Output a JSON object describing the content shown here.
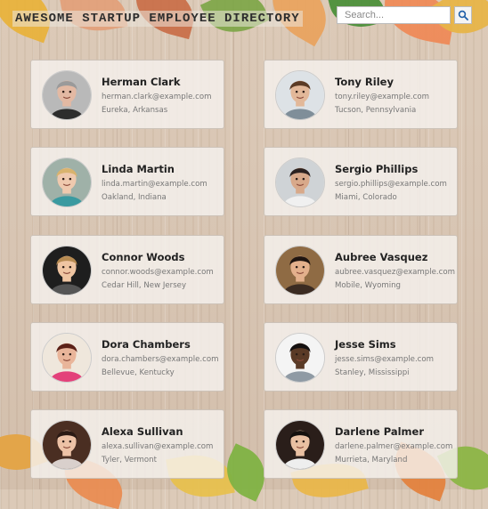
{
  "header": {
    "title": "AWESOME STARTUP EMPLOYEE DIRECTORY"
  },
  "search": {
    "placeholder": "Search...",
    "value": "",
    "icon": "magnifier-icon"
  },
  "employees": [
    {
      "name": "Herman Clark",
      "email": "herman.clark@example.com",
      "location": "Eureka, Arkansas",
      "avatar_bg": "#b9b9b9",
      "skin": "#e3b9a3",
      "hair": "#9a9a9a",
      "shirt": "#2d2d2d"
    },
    {
      "name": "Tony Riley",
      "email": "tony.riley@example.com",
      "location": "Tucson, Pennsylvania",
      "avatar_bg": "#dde2e6",
      "skin": "#e2b899",
      "hair": "#5b3b25",
      "shirt": "#7f8e99"
    },
    {
      "name": "Linda Martin",
      "email": "linda.martin@example.com",
      "location": "Oakland, Indiana",
      "avatar_bg": "#9fb1a8",
      "skin": "#efc9ae",
      "hair": "#d9b36e",
      "shirt": "#3a9aa0"
    },
    {
      "name": "Sergio Phillips",
      "email": "sergio.phillips@example.com",
      "location": "Miami, Colorado",
      "avatar_bg": "#cfd3d6",
      "skin": "#d8a98a",
      "hair": "#2c2220",
      "shirt": "#f0f0f0"
    },
    {
      "name": "Connor Woods",
      "email": "connor.woods@example.com",
      "location": "Cedar Hill, New Jersey",
      "avatar_bg": "#1e1e1e",
      "skin": "#efc5a2",
      "hair": "#b78b52",
      "shirt": "#555555"
    },
    {
      "name": "Aubree Vasquez",
      "email": "aubree.vasquez@example.com",
      "location": "Mobile, Wyoming",
      "avatar_bg": "#8f6b44",
      "skin": "#e3b08c",
      "hair": "#1f1410",
      "shirt": "#3b2b22"
    },
    {
      "name": "Dora Chambers",
      "email": "dora.chambers@example.com",
      "location": "Bellevue, Kentucky",
      "avatar_bg": "#efe7dc",
      "skin": "#e9b59a",
      "hair": "#5b2016",
      "shirt": "#e3417a"
    },
    {
      "name": "Jesse Sims",
      "email": "jesse.sims@example.com",
      "location": "Stanley, Mississippi",
      "avatar_bg": "#f4f4f4",
      "skin": "#5a3a26",
      "hair": "#141010",
      "shirt": "#8f9aa4"
    },
    {
      "name": "Alexa Sullivan",
      "email": "alexa.sullivan@example.com",
      "location": "Tyler, Vermont",
      "avatar_bg": "#4a2e22",
      "skin": "#edc2a6",
      "hair": "#2b1a14",
      "shirt": "#d9d0cc"
    },
    {
      "name": "Darlene Palmer",
      "email": "darlene.palmer@example.com",
      "location": "Murrieta, Maryland",
      "avatar_bg": "#2a1e1a",
      "skin": "#e9c0a2",
      "hair": "#15100d",
      "shirt": "#eeeeee"
    }
  ],
  "colors": {
    "card_bg": "#f5f2ee",
    "name_text": "#222222",
    "meta_text": "#777777"
  }
}
